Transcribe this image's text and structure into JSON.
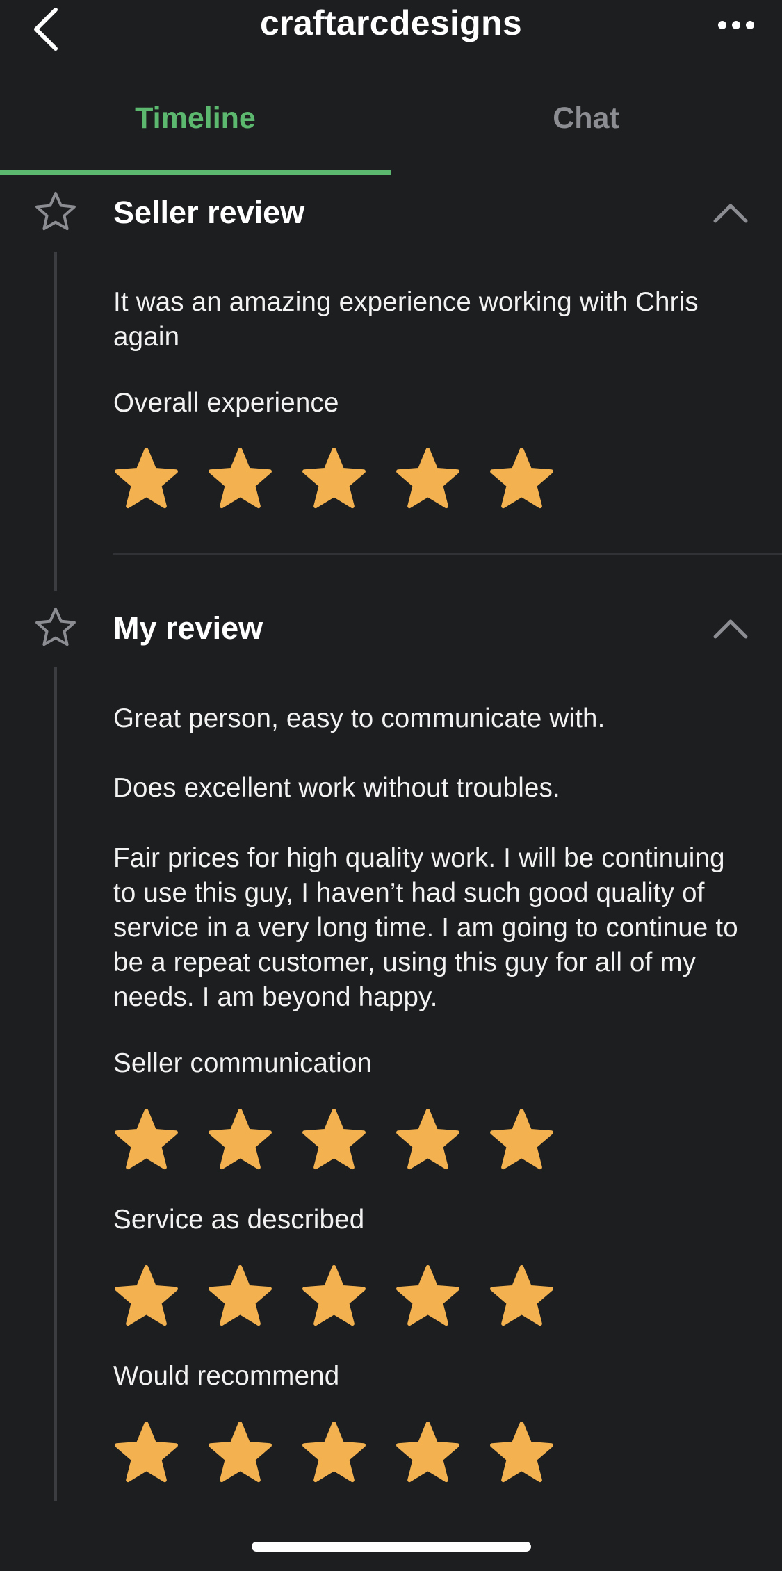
{
  "header": {
    "title": "craftarcdesigns",
    "back_icon": "chevron-left-icon",
    "more_icon": "more-horizontal-icon"
  },
  "tabs": [
    {
      "label": "Timeline",
      "active": true
    },
    {
      "label": "Chat",
      "active": false
    }
  ],
  "colors": {
    "background": "#1d1e20",
    "accent": "#5db86f",
    "star": "#f3b24f",
    "inactive_tab": "#8b8d92"
  },
  "seller_review": {
    "title": "Seller review",
    "icon": "star-outline-icon",
    "text": "It was an amazing experience working with Chris again",
    "ratings": [
      {
        "label": "Overall experience",
        "stars": 5,
        "max": 5
      }
    ]
  },
  "my_review": {
    "title": "My review",
    "icon": "star-outline-icon",
    "paragraphs": [
      "Great person, easy to communicate with.",
      "Does excellent work without troubles.",
      "Fair prices for high quality work. I will be continuing to use this guy, I haven’t had such good quality of service in a very long time. I am going to continue to be a repeat customer, using this guy for all of my needs. I am beyond happy."
    ],
    "ratings": [
      {
        "label": "Seller communication",
        "stars": 5,
        "max": 5
      },
      {
        "label": "Service as described",
        "stars": 5,
        "max": 5
      },
      {
        "label": "Would recommend",
        "stars": 5,
        "max": 5
      }
    ]
  }
}
